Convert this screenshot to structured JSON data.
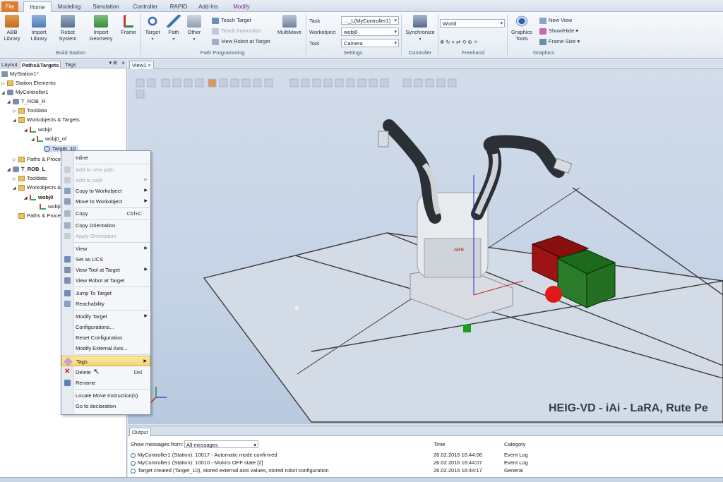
{
  "ribbon_tabs": [
    "File",
    "Home",
    "Modeling",
    "Simulation",
    "Controller",
    "RAPID",
    "Add-Ins",
    "Modify"
  ],
  "ribbon": {
    "abb_library": "ABB\nLibrary",
    "import_library": "Import\nLibrary",
    "robot_system": "Robot\nSystem",
    "import_geometry": "Import\nGeometry",
    "frame": "Frame",
    "build_station_group": "Build Station",
    "target": "Target",
    "path": "Path",
    "other": "Other",
    "teach_target": "Teach Target",
    "teach_instruction": "Teach Instruction",
    "view_robot_at_target": "View Robot at Target",
    "multimove": "MultiMove",
    "path_programming_group": "Path Programming",
    "task_label": "Task",
    "task_value": "..._L(MyController1)",
    "workobject_label": "Workobject",
    "workobject_value": "wobj0",
    "tool_label": "Tool",
    "tool_value": "Camera",
    "settings_group": "Settings",
    "synchronize": "Synchronize",
    "controller_group": "Controller",
    "frame_combo": "World",
    "freehand_group": "Freehand",
    "graphics_tools": "Graphics\nTools",
    "new_view": "New View",
    "show_hide": "Show/Hide",
    "frame_size": "Frame Size",
    "graphics_group": "Graphics"
  },
  "left_panel": {
    "tabs": [
      "Layout",
      "Paths&Targets",
      "Tags"
    ],
    "tree": [
      {
        "label": "MyStation1*",
        "icon": "station-icon"
      },
      {
        "label": "Station Elements",
        "icon": "folder-icon"
      },
      {
        "label": "MyController1",
        "icon": "controller-icon"
      },
      {
        "label": "T_ROB_R",
        "icon": "robot-task-icon"
      },
      {
        "label": "Tooldata",
        "icon": "folder-icon"
      },
      {
        "label": "Workobjects & Targets",
        "icon": "folder-icon"
      },
      {
        "label": "wobj0",
        "icon": "workobject-icon"
      },
      {
        "label": "wobj0_of",
        "icon": "workobject-icon"
      },
      {
        "label": "Target_10",
        "icon": "target-icon"
      },
      {
        "label": "Paths & Procedures",
        "icon": "folder-icon"
      },
      {
        "label": "T_ROB_L",
        "icon": "robot-task-icon"
      },
      {
        "label": "Tooldata",
        "icon": "folder-icon"
      },
      {
        "label": "Workobjects & Targets",
        "icon": "folder-icon"
      },
      {
        "label": "wobj0",
        "icon": "workobject-icon"
      },
      {
        "label": "wobj0_of",
        "icon": "workobject-icon"
      },
      {
        "label": "Paths & Procedures",
        "icon": "folder-icon"
      }
    ]
  },
  "view": {
    "tab_label": "View1",
    "watermark": "HEIG-VD - iAi - LaRA, Rute Pe"
  },
  "context_menu": [
    {
      "label": "Inline",
      "enabled": true
    },
    {
      "label": "Add to new path",
      "enabled": false
    },
    {
      "label": "Add to path",
      "enabled": false,
      "submenu": true
    },
    {
      "label": "Copy to Workobject",
      "enabled": true,
      "submenu": true
    },
    {
      "label": "Move to Workobject",
      "enabled": true,
      "submenu": true
    },
    {
      "label": "Copy",
      "enabled": true,
      "shortcut": "Ctrl+C"
    },
    {
      "label": "Copy Orientation",
      "enabled": true
    },
    {
      "label": "Apply Orientation",
      "enabled": false
    },
    {
      "label": "View",
      "enabled": true,
      "submenu": true
    },
    {
      "label": "Set as UCS",
      "enabled": true
    },
    {
      "label": "View Tool at Target",
      "enabled": true,
      "submenu": true
    },
    {
      "label": "View Robot at Target",
      "enabled": true
    },
    {
      "label": "Jump To Target",
      "enabled": true
    },
    {
      "label": "Reachability",
      "enabled": true
    },
    {
      "label": "Modify Target",
      "enabled": true,
      "submenu": true
    },
    {
      "label": "Configurations...",
      "enabled": true
    },
    {
      "label": "Reset Configuration",
      "enabled": true
    },
    {
      "label": "Modify External Axis...",
      "enabled": true
    },
    {
      "label": "Tags",
      "enabled": true,
      "submenu": true,
      "highlighted": true
    },
    {
      "label": "Delete",
      "enabled": true,
      "shortcut": "Del"
    },
    {
      "label": "Rename",
      "enabled": true
    },
    {
      "label": "Locate Move Instruction(s)",
      "enabled": true
    },
    {
      "label": "Go to declaration",
      "enabled": true
    }
  ],
  "output": {
    "tab_label": "Output",
    "filter_label": "Show messages from:",
    "filter_value": "All messages",
    "col_time": "Time",
    "col_category": "Category",
    "rows": [
      {
        "message": "MyController1 (Station): 10017 - Automatic mode confirmed",
        "time": "26.02.2016 16:44:06",
        "category": "Event Log"
      },
      {
        "message": "MyController1 (Station): 10010 - Motors OFF state [2]",
        "time": "26.02.2016 16:44:07",
        "category": "Event Log"
      },
      {
        "message": "Target created (Target_10), stored external axis values, stored robot configuration",
        "time": "26.02.2016 16:44:17",
        "category": "General"
      }
    ]
  },
  "colors": {
    "file_tab": "#e07a2c",
    "highlight": "#f5d473",
    "accent": "#3b6db3"
  }
}
